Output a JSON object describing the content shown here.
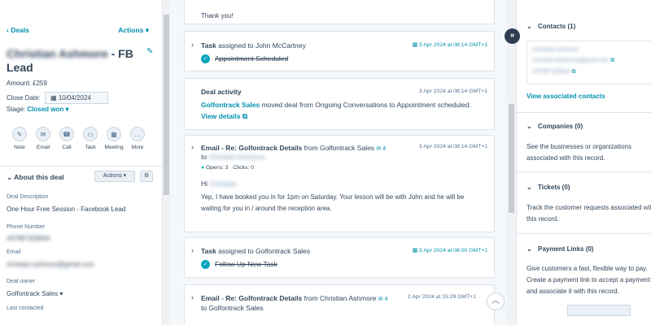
{
  "left": {
    "back_link": "‹ Deals",
    "actions_label": "Actions ▾",
    "name": "Christian Ashmore",
    "name_suffix": " - FB Lead",
    "amount": "Amount: £259",
    "close_date_label": "Close Date:",
    "close_date_value": "10/04/2024",
    "stage_label": "Stage:",
    "stage_value": "Closed won ▾",
    "actions": [
      {
        "label": "Note",
        "icon": "note-icon",
        "glyph": "✎"
      },
      {
        "label": "Email",
        "icon": "email-icon",
        "glyph": "✉"
      },
      {
        "label": "Call",
        "icon": "phone-icon",
        "glyph": "☎"
      },
      {
        "label": "Task",
        "icon": "task-icon",
        "glyph": "▭"
      },
      {
        "label": "Meeting",
        "icon": "calendar-icon",
        "glyph": "▦"
      },
      {
        "label": "More",
        "icon": "more-icon",
        "glyph": "…"
      }
    ],
    "about": {
      "title": "About this deal",
      "actions_btn": "Actions ▾",
      "gear": "⚙"
    },
    "props": {
      "desc_label": "Deal Description",
      "desc_value": "One Hour Free Session - Facebook Lead",
      "phone_label": "Phone Number",
      "phone_value": "447887328844",
      "email_label": "Email",
      "email_value": "christian.ashmore@gmail.com",
      "owner_label": "Deal owner",
      "owner_value": "Golfontrack Sales ▾",
      "last_label": "Last contacted"
    }
  },
  "feed": {
    "thank_you": "Thank you!",
    "task1": {
      "prefix": "Task",
      "rest": " assigned to John McCartney",
      "date": "3 Apr 2024 at 08:14 GMT+1",
      "status": "Appointment Scheduled"
    },
    "activity": {
      "title": "Deal activity",
      "date": "3 Apr 2024 at 08:14 GMT+1",
      "owner": "Golfontrack Sales",
      "text": " moved deal from Ongoing Conversations to Appointment scheduled.",
      "link": "View details ⧉"
    },
    "email1": {
      "prefix": "Email - Re: Golfontrack Details",
      "from": " from Golfontrack Sales",
      "count": "4",
      "date": "3 Apr 2024 at 08:14 GMT+1",
      "to": "to",
      "to_name": "Christian Ashmore",
      "opens": "Opens: 3",
      "clicks": "Clicks: 0",
      "greeting": "Hi",
      "greeting_name": "Christian",
      "body1": "Yep, I have booked you in for 1pm on Saturday. Your lesson will be with John and he will be",
      "body2": "waiting for you in / around the reception area."
    },
    "task2": {
      "prefix": "Task",
      "rest": " assigned to Golfontrack Sales",
      "date": "3 Apr 2024 at 08:00 GMT+1",
      "status": "Follow Up New Task"
    },
    "email2": {
      "prefix": "Email - Re: Golfontrack Details",
      "from": " from Christian Ashmore",
      "count": "4",
      "date": "2 Apr 2024 at 15:29 GMT+1",
      "to": "to Golfontrack Sales"
    }
  },
  "right": {
    "contacts_title": "Contacts (1)",
    "contact_name": "Christian Ashmore",
    "contact_email": "christian.ashmore@gmail.com",
    "contact_phone": "447887328844",
    "view_contacts": "View associated contacts",
    "companies_title": "Companies (0)",
    "companies_text": "See the businesses or organizations associated with this record.",
    "tickets_title": "Tickets (0)",
    "tickets_text": "Track the customer requests associated with this record.",
    "payment_title": "Payment Links (0)",
    "payment_text": "Give customers a fast, flexible way to pay. Create a payment link to accept a payment and associate it with this record."
  }
}
